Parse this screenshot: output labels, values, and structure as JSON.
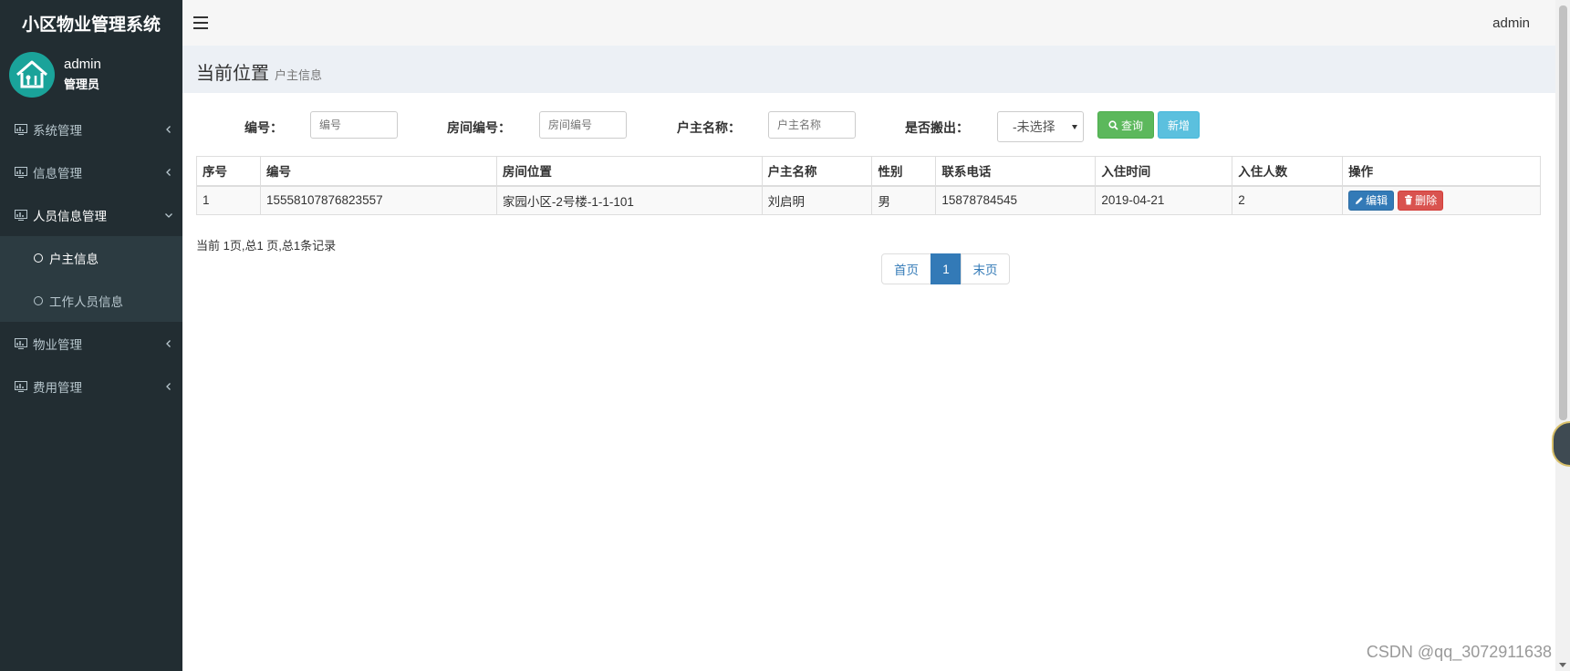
{
  "sidebar": {
    "logo_title": "小区物业管理系统",
    "user": {
      "name": "admin",
      "role": "管理员"
    },
    "menu": [
      {
        "label": "系统管理"
      },
      {
        "label": "信息管理"
      },
      {
        "label": "人员信息管理",
        "expanded": true,
        "children": [
          {
            "label": "户主信息",
            "active": true
          },
          {
            "label": "工作人员信息"
          }
        ]
      },
      {
        "label": "物业管理"
      },
      {
        "label": "费用管理"
      }
    ]
  },
  "topbar": {
    "username": "admin"
  },
  "header": {
    "title": "当前位置",
    "subtitle": "户主信息"
  },
  "search": {
    "id_label": "编号：",
    "id_placeholder": "编号",
    "room_label": "房间编号：",
    "room_placeholder": "房间编号",
    "owner_label": "户主名称：",
    "owner_placeholder": "户主名称",
    "moved_label": "是否搬出：",
    "moved_selected": "-未选择",
    "query_label": "查询",
    "add_label": "新增"
  },
  "table": {
    "headers": [
      "序号",
      "编号",
      "房间位置",
      "户主名称",
      "性别",
      "联系电话",
      "入住时间",
      "入住人数",
      "操作"
    ],
    "rows": [
      {
        "index": "1",
        "code": "15558107876823557",
        "room": "家园小区-2号楼-1-1-101",
        "owner": "刘启明",
        "gender": "男",
        "phone": "15878784545",
        "date": "2019-04-21",
        "count": "2",
        "edit_label": "编辑",
        "delete_label": "删除"
      }
    ]
  },
  "pagination": {
    "info": "当前 1页,总1 页,总1条记录",
    "first": "首页",
    "current": "1",
    "last": "末页"
  },
  "watermark": "CSDN @qq_3072911638",
  "colors": {
    "sidebar_bg": "#222d32",
    "submenu_bg": "#2c3b41",
    "primary": "#337ab7",
    "success": "#5cb85c",
    "info": "#5bc0de",
    "danger": "#d9534f",
    "avatar": "#1aa39a"
  }
}
